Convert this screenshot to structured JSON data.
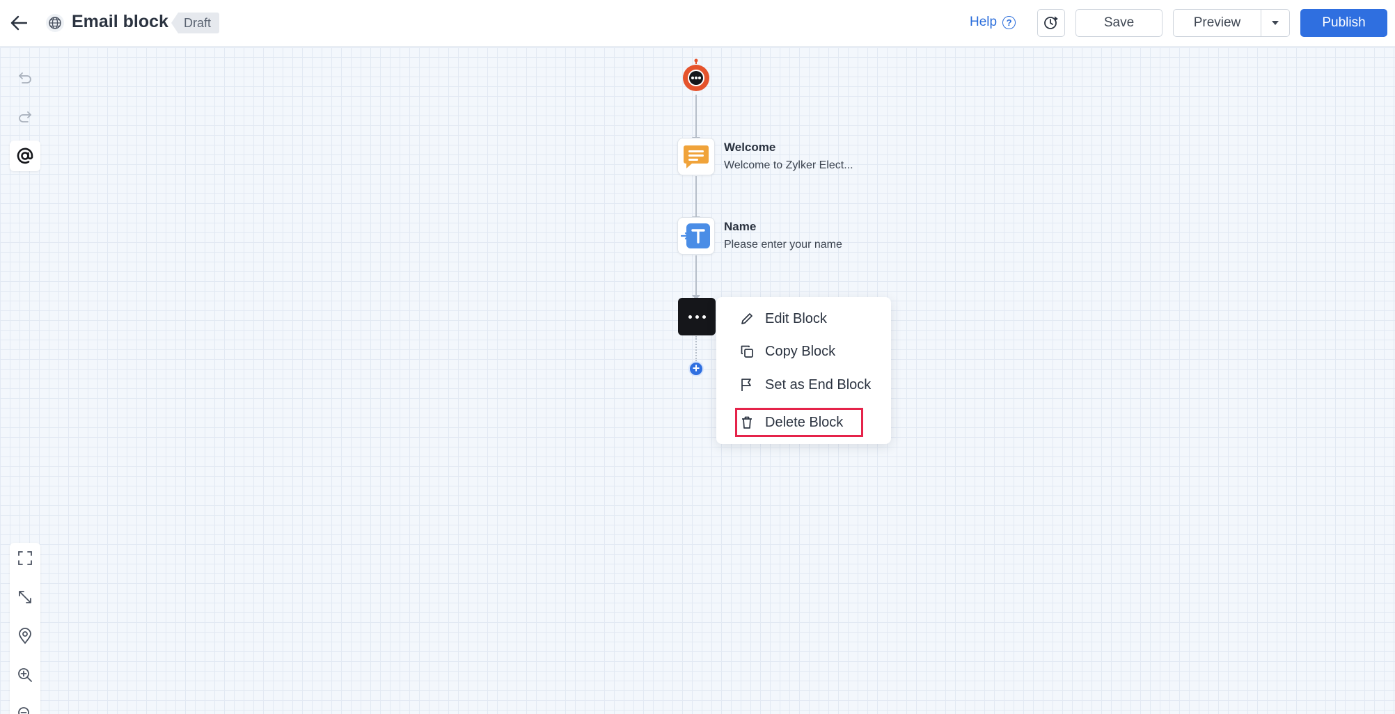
{
  "header": {
    "title": "Email block",
    "status_badge": "Draft",
    "help_label": "Help",
    "save_label": "Save",
    "preview_label": "Preview",
    "publish_label": "Publish"
  },
  "flow": {
    "nodes": [
      {
        "title": "Welcome",
        "subtitle": "Welcome to Zylker Elect..."
      },
      {
        "title": "Name",
        "subtitle": "Please enter your name"
      }
    ]
  },
  "context_menu": {
    "items": [
      {
        "label": "Edit Block",
        "icon": "pencil-icon"
      },
      {
        "label": "Copy Block",
        "icon": "copy-icon"
      },
      {
        "label": "Set as End Block",
        "icon": "flag-icon"
      },
      {
        "label": "Delete Block",
        "icon": "trash-icon"
      }
    ],
    "highlighted_item": "Delete Block"
  },
  "colors": {
    "primary": "#2f6fe0",
    "bot_orange": "#e5532c",
    "message_orange": "#f0a33a",
    "input_blue": "#4a8de6",
    "highlight_red": "#e5234a"
  }
}
